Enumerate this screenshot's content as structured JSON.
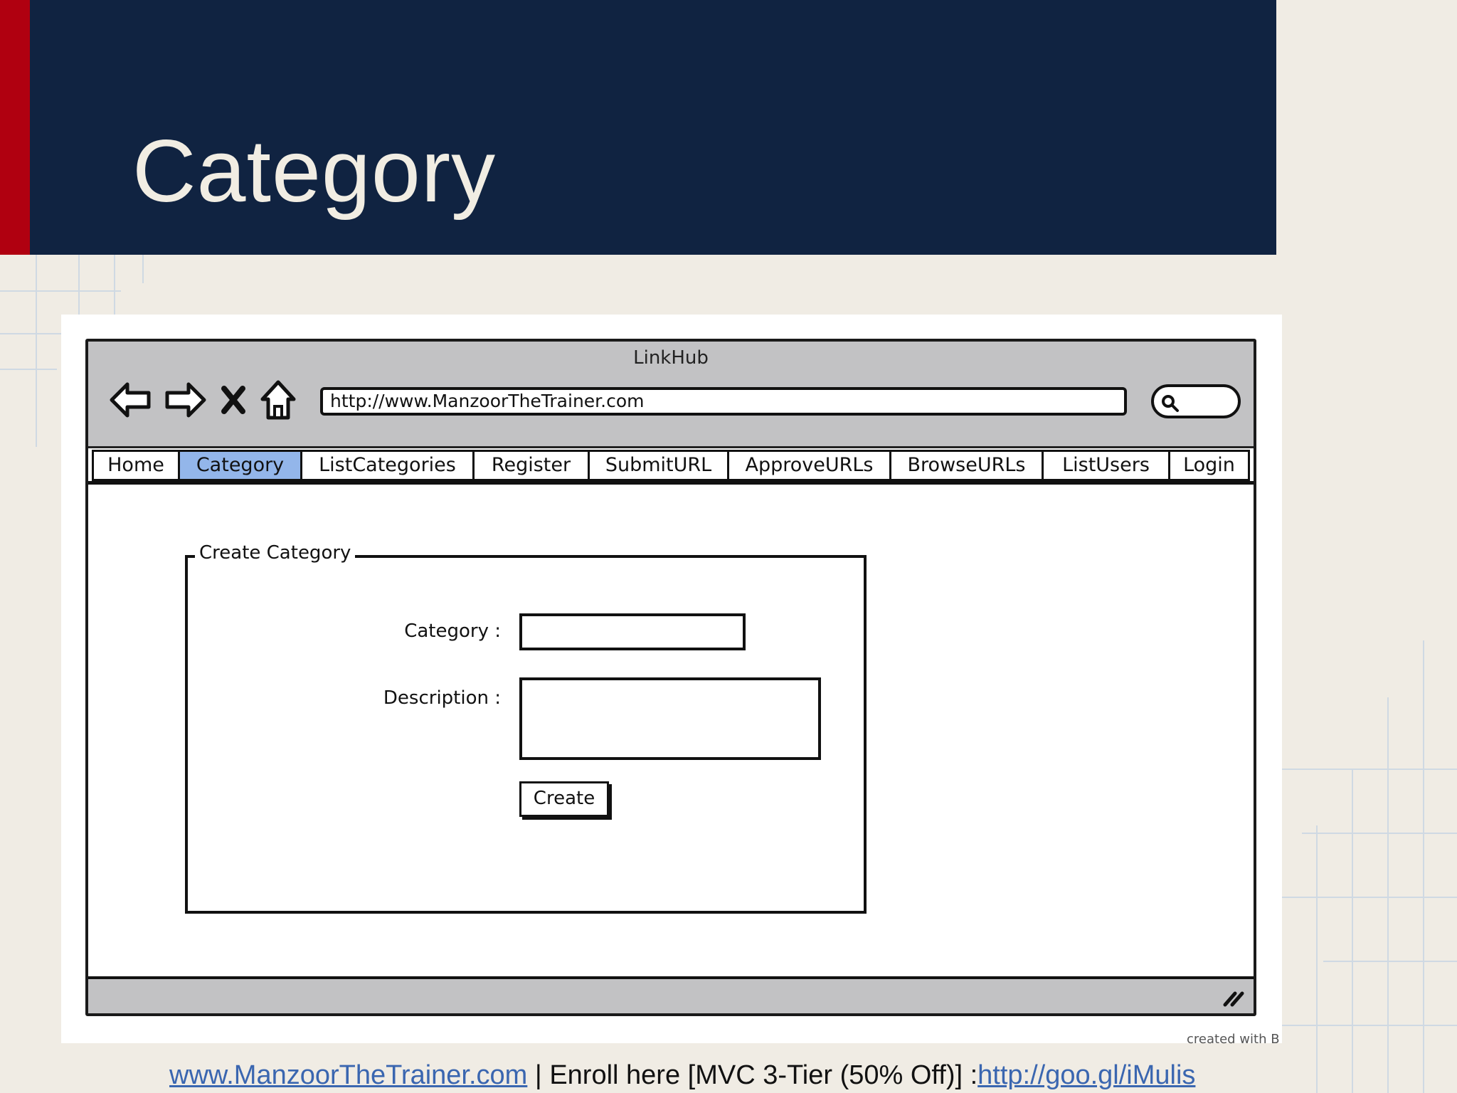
{
  "slide": {
    "title": "Category"
  },
  "browser": {
    "window_title": "LinkHub",
    "url": "http://www.ManzoorTheTrainer.com",
    "nav_icons": [
      "back-arrow-icon",
      "forward-arrow-icon",
      "stop-icon",
      "home-icon"
    ],
    "search_icon": "search-icon"
  },
  "tabs": [
    {
      "label": "Home",
      "active": false
    },
    {
      "label": "Category",
      "active": true
    },
    {
      "label": "ListCategories",
      "active": false
    },
    {
      "label": "Register",
      "active": false
    },
    {
      "label": "SubmitURL",
      "active": false
    },
    {
      "label": "ApproveURLs",
      "active": false
    },
    {
      "label": "BrowseURLs",
      "active": false
    },
    {
      "label": "ListUsers",
      "active": false
    },
    {
      "label": "Login",
      "active": false
    }
  ],
  "form": {
    "legend": "Create Category",
    "category_label": "Category :",
    "category_value": "",
    "description_label": "Description :",
    "description_value": "",
    "create_button": "Create"
  },
  "watermark": "created with B",
  "footer": {
    "link1": "www.ManzoorTheTrainer.com",
    "middle": " | Enroll here [MVC 3-Tier (50% Off)] :",
    "link2": "http://goo.gl/iMulis"
  },
  "colors": {
    "header_bg": "#102341",
    "accent_red": "#b00010",
    "active_tab": "#93b6ea",
    "page_bg": "#f0ece4",
    "link": "#3a66b0"
  }
}
